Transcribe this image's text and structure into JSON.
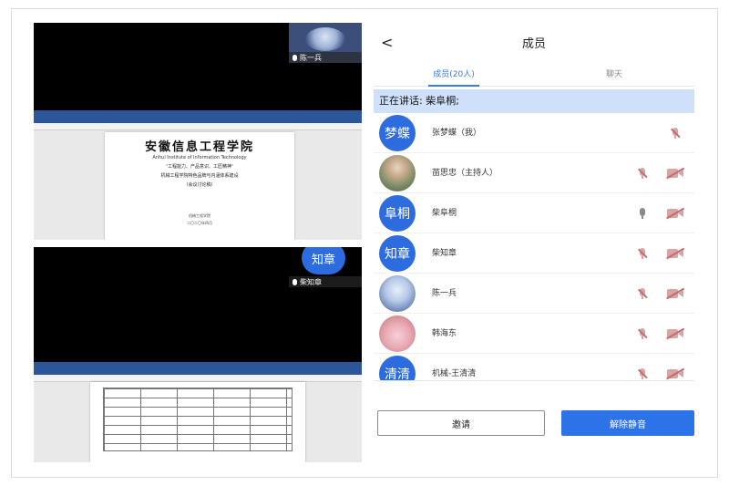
{
  "videos": [
    {
      "thumb_name": "陈一兵",
      "doc": {
        "school_cn": "安徽信息工程学院",
        "school_en": "Anhui Institute of Information Technology",
        "line1": "“工程能力、产品意识、工匠精神”",
        "line2": "机械工程学院特色品牌与内涵体系建设",
        "line3": "（会议讨论稿）",
        "date_line1": "机械工程学院",
        "date_line2": "二〇二〇年四月"
      }
    },
    {
      "thumb_name": "柴知章",
      "thumb_avatar_text": "知章"
    }
  ],
  "panel": {
    "back_glyph": "<",
    "title": "成员",
    "tabs": [
      {
        "label": "成员(20人)",
        "active": true
      },
      {
        "label": "聊天",
        "active": false
      }
    ],
    "speaking": "正在讲话: 柴阜桐;",
    "members": [
      {
        "avatar_text": "梦蝶",
        "avatar_style": "blue",
        "name": "张梦蝶（我）",
        "mic": "off",
        "cam": null
      },
      {
        "avatar_text": "",
        "avatar_style": "photo1",
        "name": "苗思忠（主持人）",
        "mic": "off",
        "cam": "off"
      },
      {
        "avatar_text": "阜桐",
        "avatar_style": "blue",
        "name": "柴阜桐",
        "mic": "on",
        "cam": "off"
      },
      {
        "avatar_text": "知章",
        "avatar_style": "blue",
        "name": "柴知章",
        "mic": "off",
        "cam": "off"
      },
      {
        "avatar_text": "",
        "avatar_style": "photo2",
        "name": "陈一兵",
        "mic": "off",
        "cam": "off"
      },
      {
        "avatar_text": "",
        "avatar_style": "pig",
        "name": "韩海东",
        "mic": "off",
        "cam": "off"
      },
      {
        "avatar_text": "清清",
        "avatar_style": "blue",
        "name": "机械-王清清",
        "mic": "off",
        "cam": "off"
      },
      {
        "avatar_text": "",
        "avatar_style": "blue",
        "name": "",
        "mic": null,
        "cam": null
      }
    ],
    "invite_label": "邀请",
    "unmute_label": "解除静音"
  },
  "icons": {
    "mic_on": "microphone-icon",
    "mic_off": "microphone-muted-icon",
    "cam_off": "camera-off-icon",
    "back": "back-arrow-icon"
  },
  "colors": {
    "accent": "#2d73e8",
    "speaking_bg": "#cfe0fb",
    "muted_red": "#c96b6b"
  }
}
